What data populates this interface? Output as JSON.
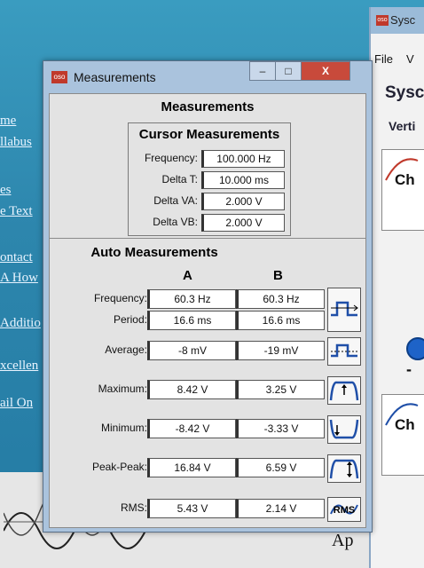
{
  "background_page": {
    "links": [
      "me",
      "llabus",
      "es",
      "e Text",
      "ontact",
      "A How",
      "Additio",
      "xcellen",
      "ail On"
    ],
    "bottom_text": "Ap"
  },
  "scope_window": {
    "title": "Sysc",
    "menu": [
      "File",
      "V"
    ],
    "heading": "Sysc",
    "section": "Verti",
    "channel_labels": [
      "Ch",
      "Ch"
    ],
    "minus": "-"
  },
  "window": {
    "title": "Measurements",
    "icon_label": "oso",
    "min_label": "–",
    "max_label": "□",
    "close_label": "X"
  },
  "heading": "Measurements",
  "cursor": {
    "title": "Cursor Measurements",
    "rows": [
      {
        "label": "Frequency:",
        "value": "100.000  Hz"
      },
      {
        "label": "Delta T:",
        "value": "10.000  ms"
      },
      {
        "label": "Delta VA:",
        "value": "2.000  V"
      },
      {
        "label": "Delta VB:",
        "value": "2.000  V"
      }
    ]
  },
  "auto": {
    "title": "Auto Measurements",
    "col_a": "A",
    "col_b": "B",
    "rows": [
      {
        "label": "Frequency:",
        "a": "60.3 Hz",
        "b": "60.3 Hz",
        "icon": "frequency-icon"
      },
      {
        "label": "Period:",
        "a": "16.6 ms",
        "b": "16.6 ms",
        "icon": "period-icon"
      },
      {
        "label": "Average:",
        "a": "-8 mV",
        "b": "-19 mV",
        "icon": "average-icon"
      },
      {
        "label": "Maximum:",
        "a": "8.42 V",
        "b": "3.25 V",
        "icon": "maximum-icon"
      },
      {
        "label": "Minimum:",
        "a": "-8.42 V",
        "b": "-3.33 V",
        "icon": "minimum-icon"
      },
      {
        "label": "Peak-Peak:",
        "a": "16.84 V",
        "b": "6.59 V",
        "icon": "peak-peak-icon"
      },
      {
        "label": "RMS:",
        "a": "5.43 V",
        "b": "2.14 V",
        "icon": "rms-icon",
        "icon_text": "RMS"
      }
    ]
  },
  "colors": {
    "window_frame": "#aac3dd",
    "client": "#e3e3e3",
    "close_button": "#c84a3b",
    "wave_blue": "#1f4fa8"
  }
}
